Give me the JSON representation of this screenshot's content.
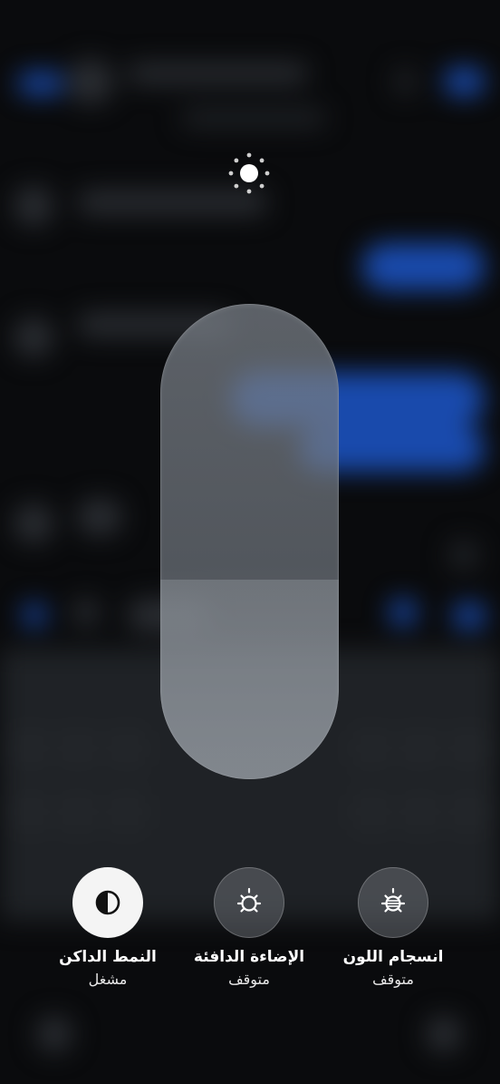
{
  "brightness": {
    "icon": "sun-icon",
    "level_fraction": 0.42
  },
  "modes": [
    {
      "icon": "dark-mode-icon",
      "label": "النمط الداكن",
      "state": "مشغل",
      "active": true
    },
    {
      "icon": "warm-light-icon",
      "label": "الإضاءة الدافئة",
      "state": "متوقف",
      "active": false
    },
    {
      "icon": "color-harmony-icon",
      "label": "انسجام اللون",
      "state": "متوقف",
      "active": false
    }
  ],
  "colors": {
    "background": "#0a0b0d",
    "accent_blue": "#1c56c9",
    "active_button": "#f4f4f4"
  }
}
